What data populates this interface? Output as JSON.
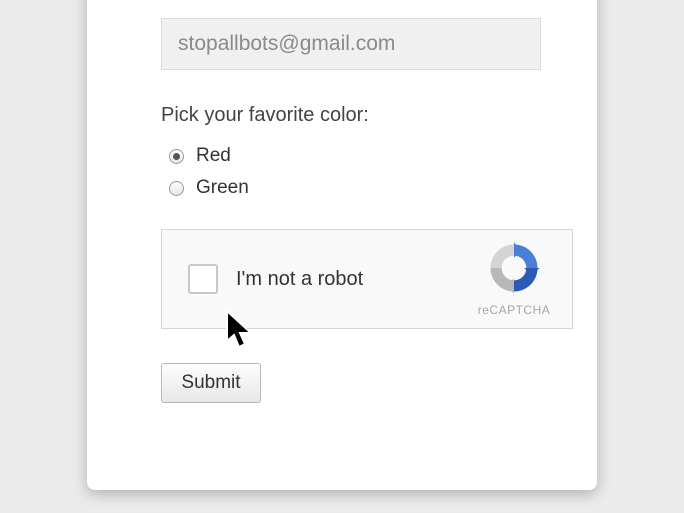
{
  "email": {
    "value": "stopallbots@gmail.com"
  },
  "color_question": {
    "label": "Pick your favorite color:"
  },
  "color_options": {
    "red": {
      "label": "Red",
      "selected": true
    },
    "green": {
      "label": "Green",
      "selected": false
    }
  },
  "recaptcha": {
    "label": "I'm not a robot",
    "brand": "reCAPTCHA"
  },
  "submit": {
    "label": "Submit"
  }
}
